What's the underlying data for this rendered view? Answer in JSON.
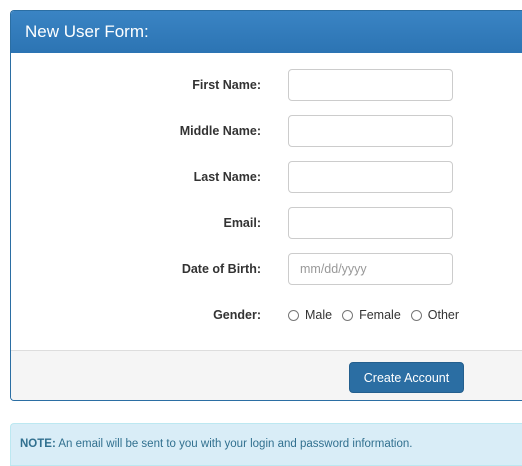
{
  "panel": {
    "title": "New User Form:"
  },
  "form": {
    "fields": [
      {
        "label": "First Name:",
        "value": "",
        "placeholder": ""
      },
      {
        "label": "Middle Name:",
        "value": "",
        "placeholder": ""
      },
      {
        "label": "Last Name:",
        "value": "",
        "placeholder": ""
      },
      {
        "label": "Email:",
        "value": "",
        "placeholder": ""
      },
      {
        "label": "Date of Birth:",
        "value": "",
        "placeholder": "mm/dd/yyyy"
      }
    ],
    "gender": {
      "label": "Gender:",
      "options": [
        "Male",
        "Female",
        "Other"
      ]
    }
  },
  "footer": {
    "submit_label": "Create Account"
  },
  "note": {
    "prefix": "NOTE:",
    "text": " An email will be sent to you with your login and password information."
  },
  "colors": {
    "header": "#2c74b3",
    "button": "#2b6ea3",
    "note_bg": "#d9edf7",
    "note_text": "#31708f"
  }
}
